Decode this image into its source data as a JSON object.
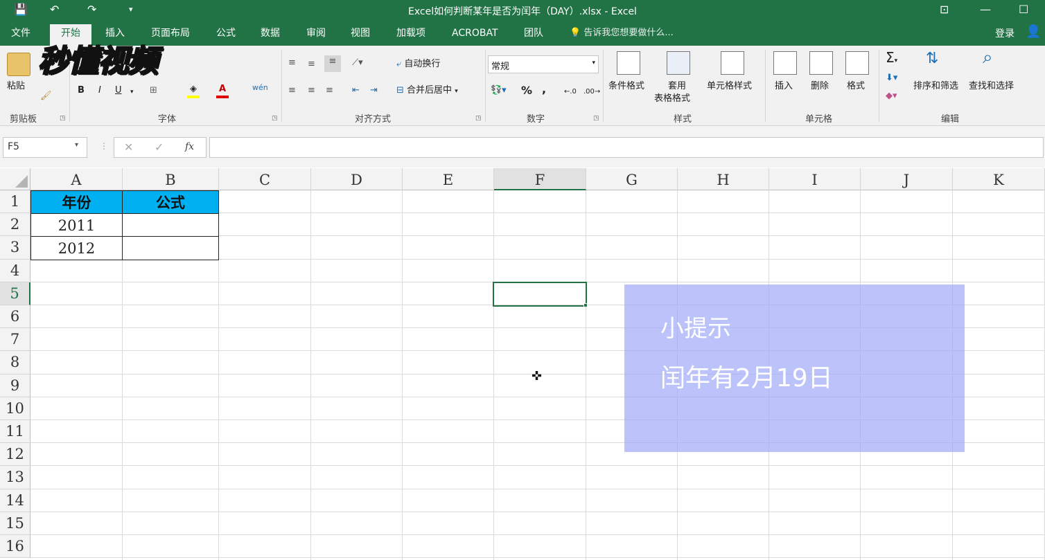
{
  "window": {
    "title": "Excel如何判断某年是否为闰年（DAY）.xlsx - Excel"
  },
  "menu": {
    "tabs": [
      "文件",
      "开始",
      "插入",
      "页面布局",
      "公式",
      "数据",
      "审阅",
      "视图",
      "加载项",
      "ACROBAT",
      "团队"
    ],
    "active": "开始",
    "tell_me": "告诉我您想要做什么...",
    "login": "登录"
  },
  "watermark": "秒懂视频",
  "ribbon": {
    "clipboard": {
      "label": "剪贴板",
      "paste": "粘贴"
    },
    "font": {
      "label": "字体",
      "bold": "B",
      "italic": "I",
      "underline": "U"
    },
    "alignment": {
      "label": "对齐方式",
      "wrap": "自动换行",
      "merge": "合并后居中"
    },
    "number": {
      "label": "数字",
      "format": "常规",
      "percent": "%",
      "comma": ","
    },
    "styles": {
      "label": "样式",
      "conditional": "条件格式",
      "table_fmt_1": "套用",
      "table_fmt_2": "表格格式",
      "cell_styles": "单元格样式"
    },
    "cells": {
      "label": "单元格",
      "insert": "插入",
      "delete": "删除",
      "format": "格式"
    },
    "editing": {
      "label": "编辑",
      "sort": "排序和筛选",
      "find": "查找和选择"
    }
  },
  "formula_bar": {
    "name_box": "F5",
    "fx": "fx",
    "formula": ""
  },
  "grid": {
    "columns": [
      "A",
      "B",
      "C",
      "D",
      "E",
      "F",
      "G",
      "H",
      "I",
      "J",
      "K"
    ],
    "rows": [
      "1",
      "2",
      "3",
      "4",
      "5",
      "6",
      "7",
      "8",
      "9",
      "10",
      "11",
      "12",
      "13",
      "14",
      "15",
      "16"
    ],
    "selected_cell": "F5",
    "cells": {
      "A1": "年份",
      "B1": "公式",
      "A2": "2011",
      "B2": "",
      "A3": "2012",
      "B3": ""
    }
  },
  "tip": {
    "title": "小提示",
    "text": "闰年有2月19日"
  },
  "colors": {
    "excel_green": "#217346",
    "header_fill": "#00b0f0",
    "tip_bg": "#a0aafa"
  }
}
